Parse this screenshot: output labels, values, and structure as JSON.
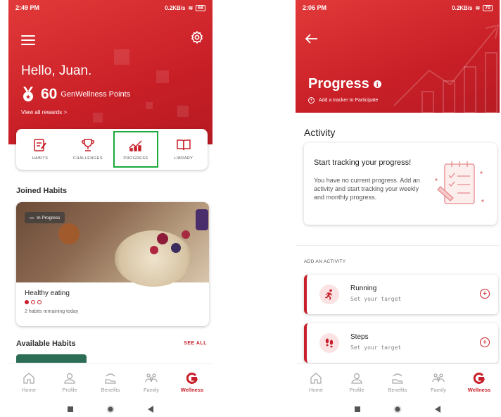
{
  "left_screen": {
    "status": {
      "time": "2:49 PM",
      "network": "0.2KB/s",
      "battery": "68"
    },
    "header": {
      "greeting": "Hello, Juan.",
      "points_value": "60",
      "points_label": "GenWellness Points",
      "view_rewards": "View all rewards >"
    },
    "quick_nav": [
      {
        "label": "HABITS",
        "icon": "habits-icon"
      },
      {
        "label": "CHALLENGES",
        "icon": "trophy-icon"
      },
      {
        "label": "PROGRESS",
        "icon": "chart-icon"
      },
      {
        "label": "LIBRARY",
        "icon": "book-icon"
      }
    ],
    "joined_habits": {
      "title": "Joined Habits",
      "card": {
        "status": "In Progress",
        "name": "Healthy eating",
        "remaining": "2 habits remaining today",
        "progress": {
          "completed": 1,
          "total": 3
        }
      }
    },
    "available_habits": {
      "title": "Available Habits",
      "see_all": "SEE ALL"
    },
    "bottom_nav": [
      {
        "label": "Home",
        "icon": "home-icon"
      },
      {
        "label": "Profile",
        "icon": "profile-icon"
      },
      {
        "label": "Benefits",
        "icon": "benefits-icon"
      },
      {
        "label": "Family",
        "icon": "family-icon"
      },
      {
        "label": "Wellness",
        "icon": "wellness-icon",
        "active": true
      }
    ]
  },
  "right_screen": {
    "status": {
      "time": "2:06 PM",
      "network": "0.2KB/s",
      "battery": "70"
    },
    "header": {
      "title": "Progress",
      "add_tracker": "Add a tracker to Participate"
    },
    "activity": {
      "title": "Activity",
      "empty_title": "Start tracking your progress!",
      "empty_body": "You have no current progress. Add an activity and start tracking your weekly and monthly progress."
    },
    "add_activity_label": "ADD AN ACTIVITY",
    "activities": [
      {
        "name": "Running",
        "subtitle": "Set your target",
        "icon": "running-icon"
      },
      {
        "name": "Steps",
        "subtitle": "Set your target",
        "icon": "footsteps-icon"
      }
    ],
    "bottom_nav": [
      {
        "label": "Home",
        "icon": "home-icon"
      },
      {
        "label": "Profile",
        "icon": "profile-icon"
      },
      {
        "label": "Benefits",
        "icon": "benefits-icon"
      },
      {
        "label": "Family",
        "icon": "family-icon"
      },
      {
        "label": "Wellness",
        "icon": "wellness-icon",
        "active": true
      }
    ]
  },
  "colors": {
    "brand_red": "#c8202a",
    "highlight_green": "#1aa93a",
    "muted_gray": "#999999"
  }
}
